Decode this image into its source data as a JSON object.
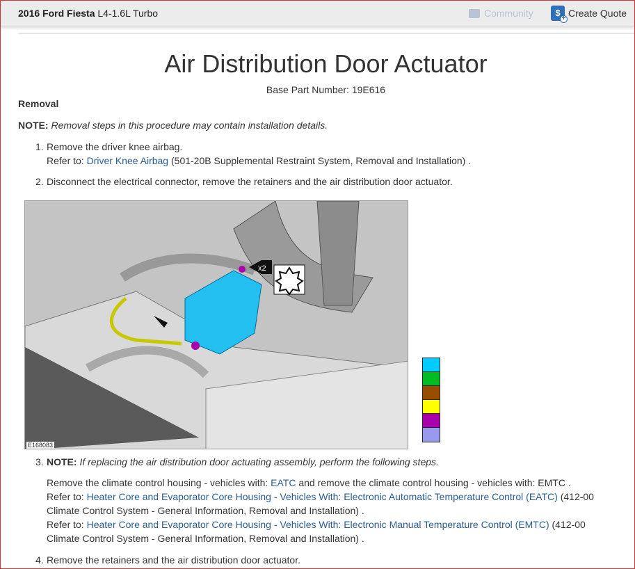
{
  "header": {
    "vehicle_bold": "2016 Ford Fiesta",
    "vehicle_engine": "L4-1.6L Turbo",
    "community": "Community",
    "create_quote": "Create Quote"
  },
  "page": {
    "title": "Air Distribution Door Actuator",
    "base_part": "Base Part Number: 19E616",
    "section": "Removal",
    "note_label": "NOTE:",
    "note_text": "Removal steps in this procedure may contain installation details."
  },
  "steps": [
    {
      "num": "1.",
      "text": "Remove the driver knee airbag.",
      "refer": "Refer to:",
      "link": "Driver Knee Airbag",
      "after": "(501-20B Supplemental Restraint System, Removal and Installation) ."
    },
    {
      "num": "2.",
      "text": "Disconnect the electrical connector, remove the retainers and the air distribution door actuator."
    },
    {
      "num": "3.",
      "note_label": "NOTE:",
      "note_text": "If replacing the air distribution door actuating assembly, perform the following steps.",
      "line1_a": "Remove the climate control housing - vehicles with:",
      "line1_link": "EATC",
      "line1_b": "and remove the climate control housing - vehicles with: EMTC .",
      "refer": "Refer to:",
      "link_a": "Heater Core and Evaporator Core Housing - Vehicles With: Electronic Automatic Temperature Control (EATC)",
      "after_a": "(412-00 Climate Control System - General Information, Removal and Installation) .",
      "link_b": "Heater Core and Evaporator Core Housing - Vehicles With: Electronic Manual Temperature Control (EMTC)",
      "after_b": "(412-00 Climate Control System - General Information, Removal and Installation) ."
    },
    {
      "num": "4.",
      "text": "Remove the retainers and the air distribution door actuator."
    }
  ],
  "figure": {
    "id": "E168083",
    "callout": "x2"
  },
  "legend_colors": [
    "#00ccff",
    "#00bb22",
    "#994d00",
    "#ffff00",
    "#aa00aa",
    "#9999ee"
  ]
}
